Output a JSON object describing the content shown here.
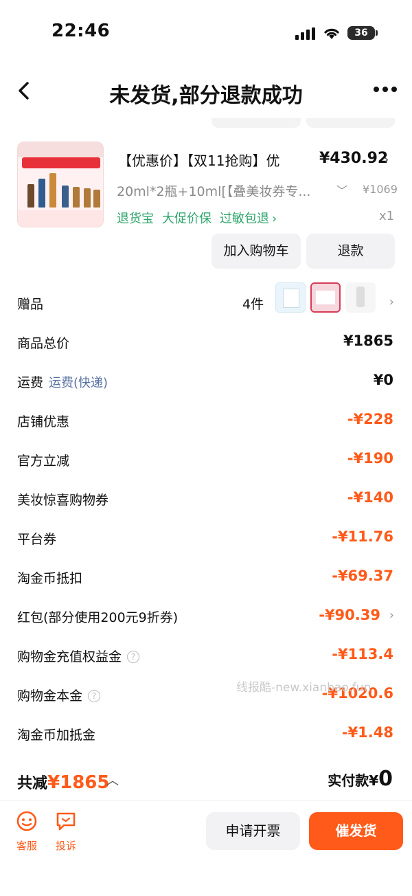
{
  "status": {
    "time": "22:46",
    "battery": "36"
  },
  "nav": {
    "title": "未发货,部分退款成功"
  },
  "product": {
    "title": "【优惠价】【双11抢购】优",
    "price": "¥430.92",
    "spec": "20ml*2瓶+10ml[【叠美妆券专...",
    "original_price": "¥1069",
    "tags": [
      "退货宝",
      "大促价保",
      "过敏包退"
    ],
    "quantity": "x1",
    "add_cart_label": "加入购物车",
    "refund_label": "退款"
  },
  "gifts": {
    "label": "赠品",
    "count": "4件"
  },
  "rows": [
    {
      "label": "商品总价",
      "value": "¥1865"
    },
    {
      "label": "运费",
      "sub": "运费(快递)",
      "value": "¥0"
    },
    {
      "label": "店铺优惠",
      "value": "-¥228"
    },
    {
      "label": "官方立减",
      "value": "-¥190"
    },
    {
      "label": "美妆惊喜购物券",
      "value": "-¥140"
    },
    {
      "label": "平台券",
      "value": "-¥11.76"
    },
    {
      "label": "淘金币抵扣",
      "value": "-¥69.37"
    },
    {
      "label": "红包(部分使用200元9折券)",
      "value": "-¥90.39"
    },
    {
      "label": "购物金充值权益金",
      "value": "-¥113.4"
    },
    {
      "label": "购物金本金",
      "value": "-¥1020.6"
    },
    {
      "label": "淘金币加抵金",
      "value": "-¥1.48"
    }
  ],
  "watermark": "线报酷-new.xianbao.fun",
  "summary": {
    "reduce_label": "共减",
    "reduce_amount": "¥1865",
    "paid_label": "实付款¥",
    "paid_amount": "0"
  },
  "bottom": {
    "service_label": "客服",
    "complaint_label": "投诉",
    "invoice_label": "申请开票",
    "urge_label": "催发货"
  },
  "colors": {
    "accent": "#ff5a19",
    "green": "#2aa36a",
    "link": "#5873a3"
  }
}
